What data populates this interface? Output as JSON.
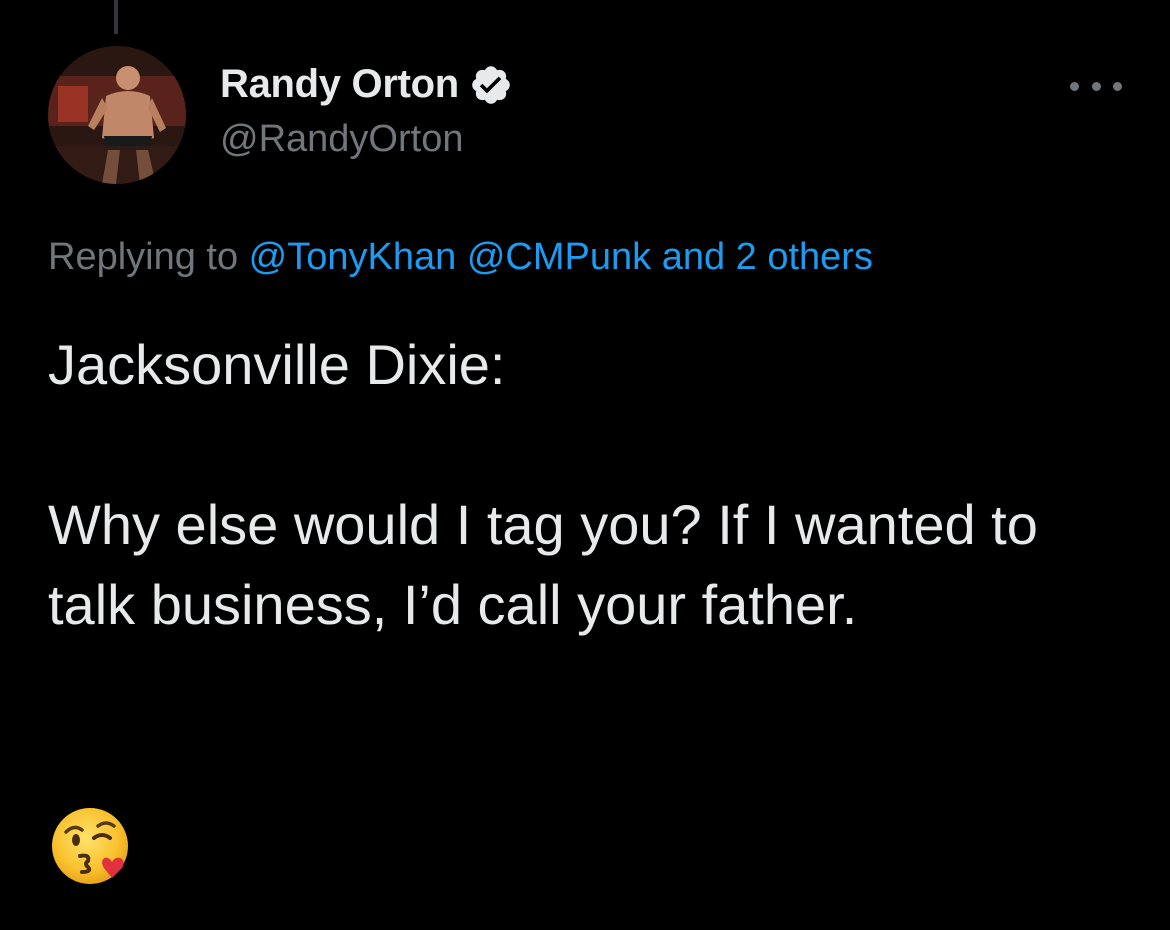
{
  "tweet": {
    "author": {
      "display_name": "Randy Orton",
      "handle": "@RandyOrton",
      "verified": true,
      "avatar_icon": "avatar-wrestler"
    },
    "reply_context": {
      "prefix": "Replying to ",
      "mentions": [
        "@TonyKhan",
        "@CMPunk"
      ],
      "others": "and 2 others"
    },
    "text": {
      "line1": "Jacksonville Dixie:",
      "line2": "Why else would I tag you? If I wanted to talk business, I’d call your father."
    },
    "emoji": "kissing-face-with-heart-emoji"
  },
  "colors": {
    "background": "#000000",
    "primary_text": "#E7E9EA",
    "secondary_text": "#71767B",
    "link": "#1D9BF0"
  }
}
